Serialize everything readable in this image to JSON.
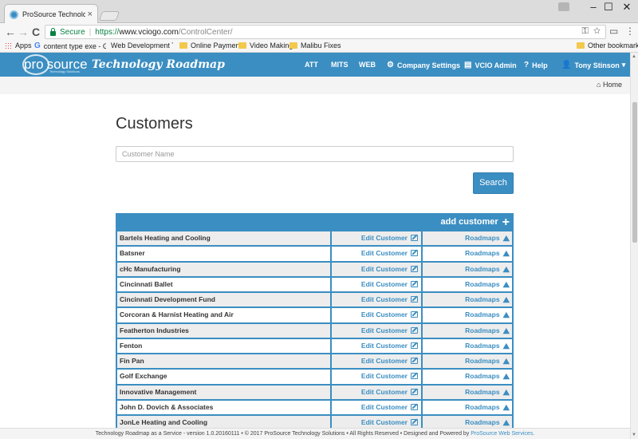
{
  "browser": {
    "tab_title": "ProSource Technology Ro",
    "tab_close": "×",
    "window_controls": {
      "minimize": "–",
      "maximize": "☐",
      "close": "✕"
    },
    "nav": {
      "back": "←",
      "forward": "→",
      "reload": "C"
    },
    "omnibox": {
      "secure_label": "Secure",
      "separator": "|",
      "url_scheme": "https://",
      "url_host": "www.vciogo.com",
      "url_path": "/ControlCenter/"
    },
    "bookmarks": [
      {
        "label": "Apps",
        "icon": "apps-grid-icon"
      },
      {
        "label": "content type exe - Go",
        "icon": "google-icon"
      },
      {
        "label": "Web Development To",
        "icon": "folder-icon"
      },
      {
        "label": "Online Payments",
        "icon": "folder-icon"
      },
      {
        "label": "Video Making",
        "icon": "folder-icon"
      },
      {
        "label": "Malibu Fixes",
        "icon": "folder-icon"
      }
    ],
    "other_bookmarks": "Other bookmarks"
  },
  "appnav": {
    "logo_pro": "pro",
    "logo_source": "source",
    "logo_sub": "Technology Solutions",
    "app_title": "Technology Roadmap",
    "items": [
      {
        "label": "ATT",
        "icon": ""
      },
      {
        "label": "MITS",
        "icon": ""
      },
      {
        "label": "WEB",
        "icon": ""
      },
      {
        "label": "Company Settings",
        "icon": "⚙"
      },
      {
        "label": "VCIO Admin",
        "icon": "▤"
      },
      {
        "label": "Help",
        "icon": "?"
      },
      {
        "label": "Tony Stinson",
        "icon": "👤"
      }
    ],
    "user_caret": "▾"
  },
  "breadcrumb": {
    "home_icon": "⌂",
    "home_label": "Home"
  },
  "page": {
    "heading": "Customers",
    "search_placeholder": "Customer Name",
    "search_button": "Search"
  },
  "table": {
    "add_customer": "add customer",
    "add_icon": "+",
    "edit_label": "Edit Customer",
    "roadmaps_label": "Roadmaps",
    "road_icon": "⛰",
    "rows": [
      "Bartels Heating and Cooling",
      "Batsner",
      "cHc Manufacturing",
      "Cincinnati Ballet",
      "Cincinnati Development Fund",
      "Corcoran & Harnist Heating and Air",
      "Featherton Industries",
      "Fenton",
      "Fin Pan",
      "Golf Exchange",
      "Innovative Management",
      "John D. Dovich & Associates",
      "JonLe Heating and Cooling"
    ]
  },
  "footer": {
    "text": "Technology Roadmap as a Service - version 1.0.20160111  •  © 2017 ProSource Technology Solutions  •  All Rights Reserved  •  Designed and Powered by",
    "link": "ProSource Web Services."
  },
  "colors": {
    "brand_blue": "#3b8ec2",
    "secure_green": "#0b8043"
  }
}
